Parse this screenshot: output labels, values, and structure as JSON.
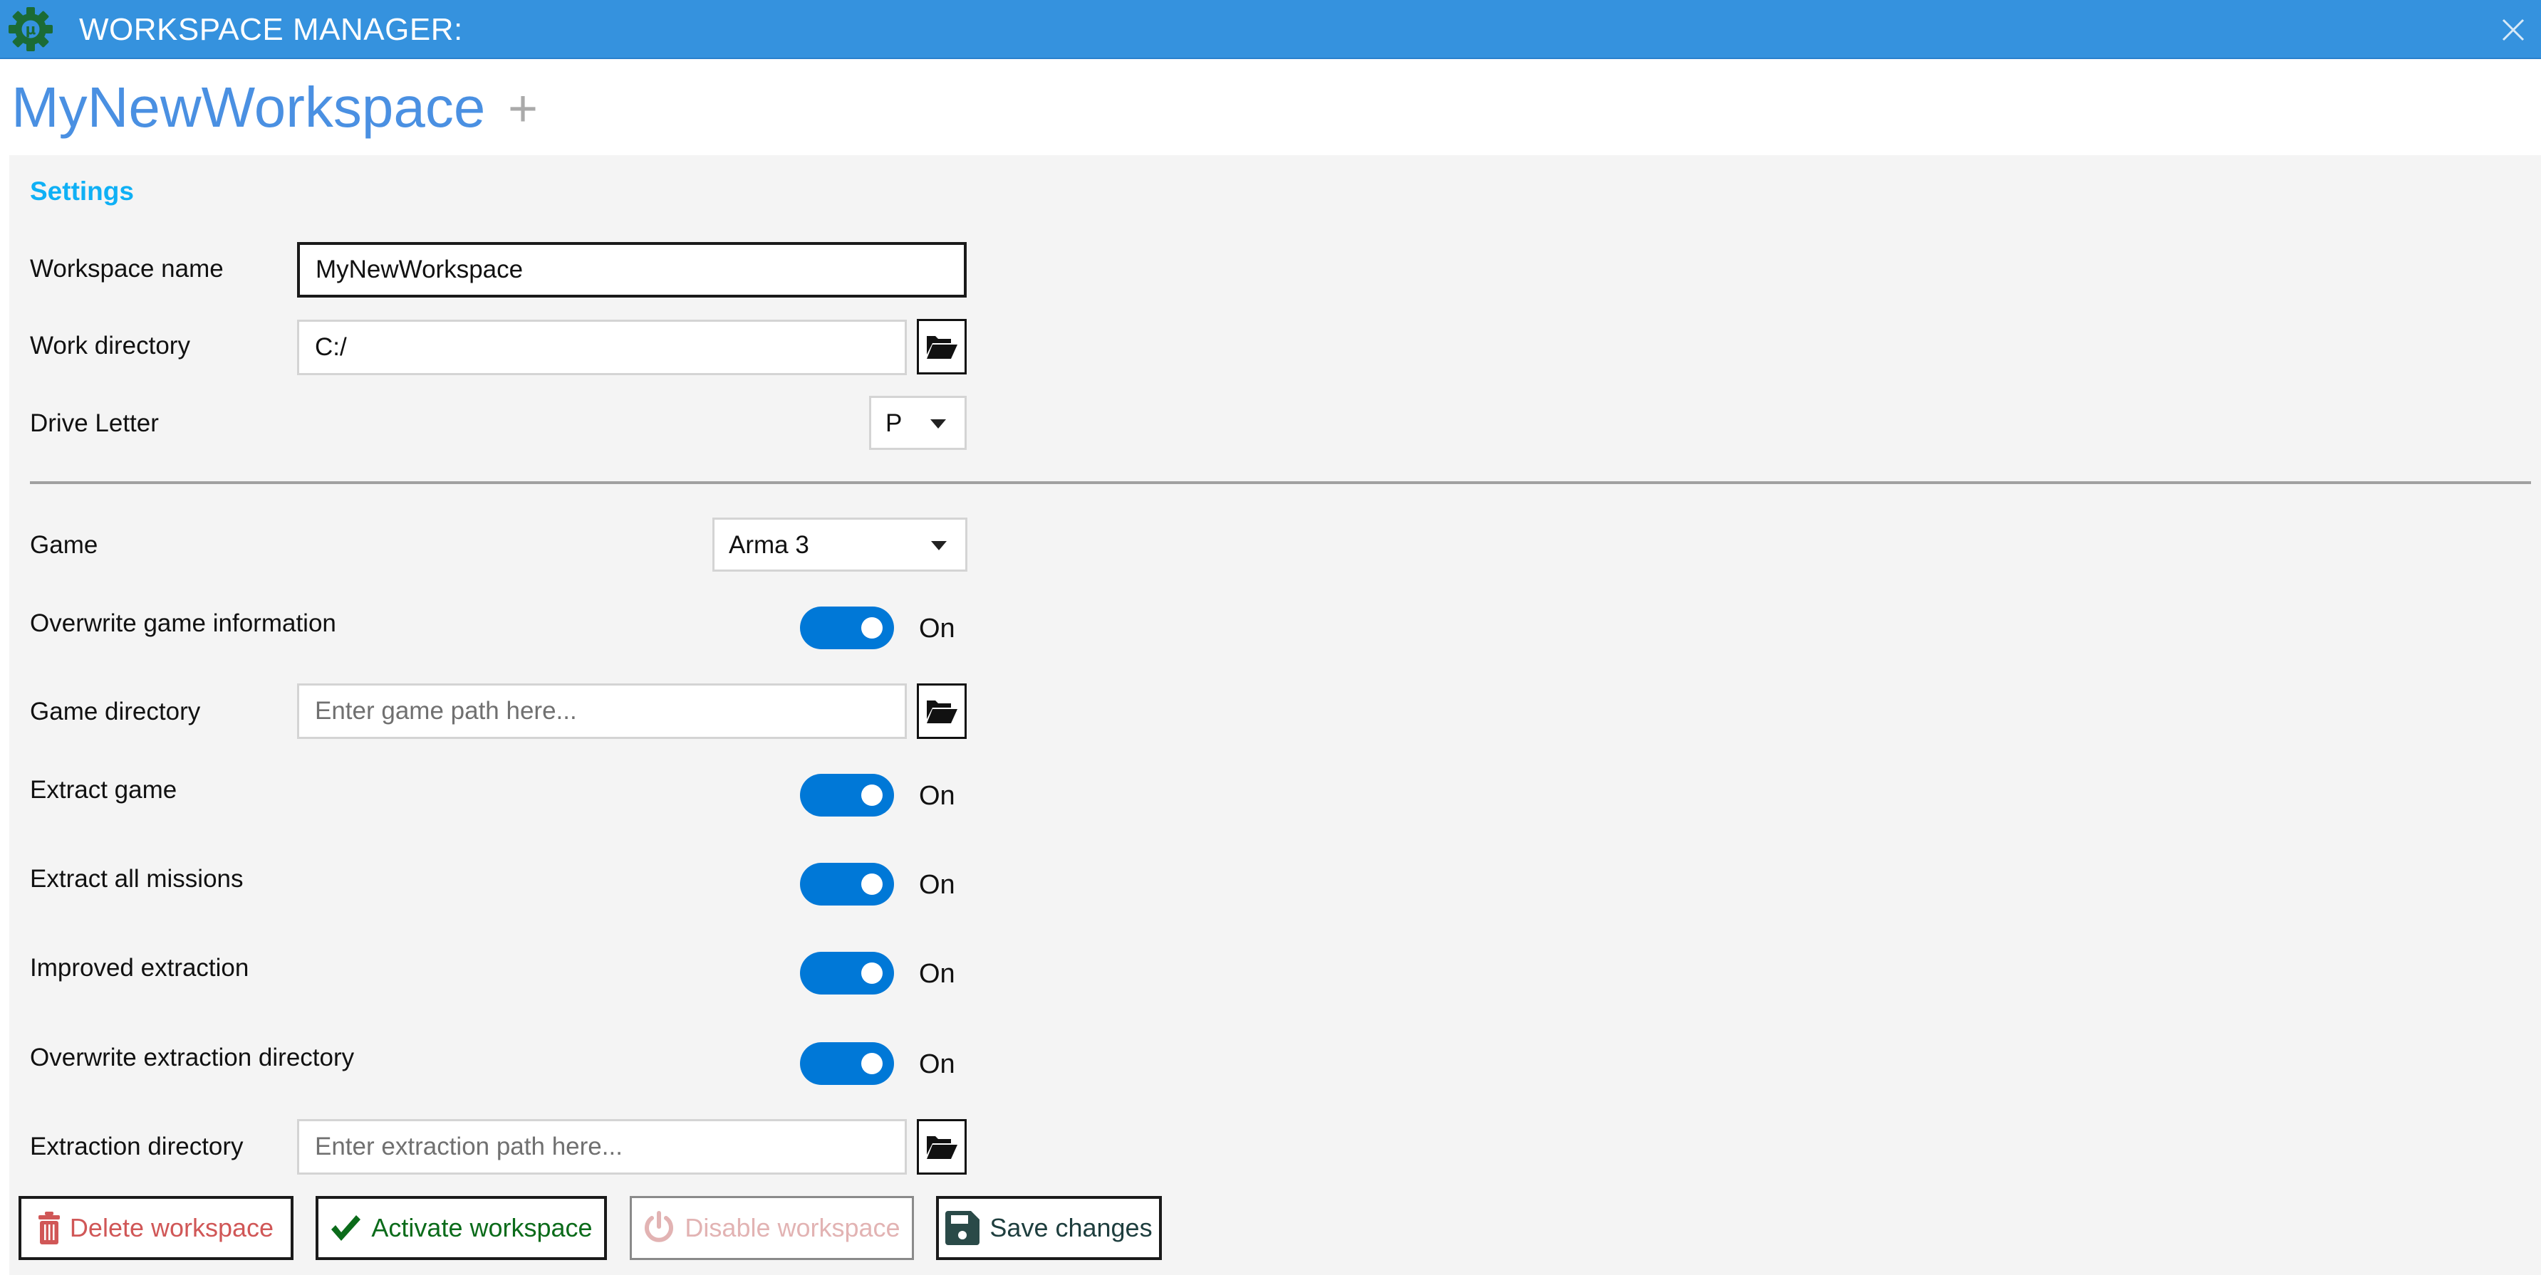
{
  "window": {
    "title": "WORKSPACE MANAGER:",
    "app_icon": "gear-mu-icon",
    "close_icon": "close-icon",
    "colors": {
      "titlebar": "#3592DE",
      "accent": "#0078D7"
    }
  },
  "tabs": {
    "active_label": "MyNewWorkspace",
    "add_label": "+"
  },
  "settings": {
    "section_title": "Settings",
    "workspace_name": {
      "label": "Workspace name",
      "value": "MyNewWorkspace"
    },
    "work_directory": {
      "label": "Work directory",
      "value": "C:/",
      "browse_icon": "folder-open-icon"
    },
    "drive_letter": {
      "label": "Drive Letter",
      "selected": "P"
    },
    "game": {
      "label": "Game",
      "selected": "Arma 3"
    },
    "overwrite_game_info": {
      "label": "Overwrite game information",
      "state": "On",
      "checked": true
    },
    "game_directory": {
      "label": "Game directory",
      "value": "",
      "placeholder": "Enter game path here...",
      "browse_icon": "folder-open-icon"
    },
    "extract_game": {
      "label": "Extract game",
      "state": "On",
      "checked": true
    },
    "extract_all_missions": {
      "label": "Extract all missions",
      "state": "On",
      "checked": true
    },
    "improved_extraction": {
      "label": "Improved extraction",
      "state": "On",
      "checked": true
    },
    "overwrite_extraction_dir": {
      "label": "Overwrite extraction directory",
      "state": "On",
      "checked": true
    },
    "extraction_directory": {
      "label": "Extraction directory",
      "value": "",
      "placeholder": "Enter extraction path here...",
      "browse_icon": "folder-open-icon"
    }
  },
  "actions": {
    "delete": {
      "label": "Delete workspace",
      "icon": "trash-icon",
      "color": "#D05757"
    },
    "activate": {
      "label": "Activate workspace",
      "icon": "checkmark-icon",
      "color": "#0B6B1A"
    },
    "disable": {
      "label": "Disable workspace",
      "icon": "power-icon",
      "color": "#E2B3B3",
      "disabled": true
    },
    "save": {
      "label": "Save changes",
      "icon": "floppy-disk-icon",
      "color": "#1E3E3E"
    }
  }
}
